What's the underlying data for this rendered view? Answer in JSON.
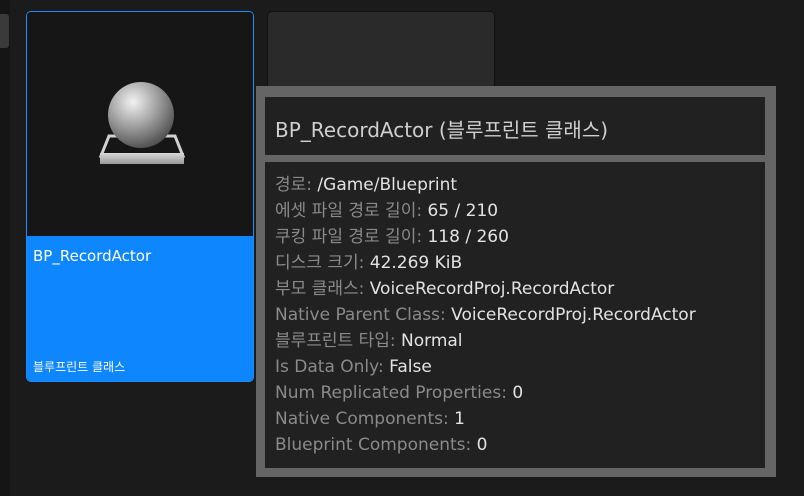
{
  "asset_tile": {
    "name": "BP_RecordActor",
    "type_label": "블루프린트 클래스",
    "thumbnail_icon": "sphere-on-pedestal-icon",
    "selected_color": "#0e86fe"
  },
  "tooltip": {
    "title": "BP_RecordActor (블루프린트 클래스)",
    "properties": [
      {
        "label": "경로: ",
        "value": "/Game/Blueprint"
      },
      {
        "label": "에셋 파일 경로 길이: ",
        "value": "65 / 210"
      },
      {
        "label": "쿠킹 파일 경로 길이: ",
        "value": "118 / 260"
      },
      {
        "label": "디스크 크기: ",
        "value": "42.269 KiB"
      },
      {
        "label": "부모 클래스: ",
        "value": "VoiceRecordProj.RecordActor"
      },
      {
        "label": "Native Parent Class: ",
        "value": "VoiceRecordProj.RecordActor"
      },
      {
        "label": "블루프린트 타입: ",
        "value": "Normal"
      },
      {
        "label": "Is Data Only: ",
        "value": "False"
      },
      {
        "label": "Num Replicated Properties: ",
        "value": "0"
      },
      {
        "label": "Native Components: ",
        "value": "1"
      },
      {
        "label": "Blueprint Components: ",
        "value": "0"
      }
    ]
  }
}
